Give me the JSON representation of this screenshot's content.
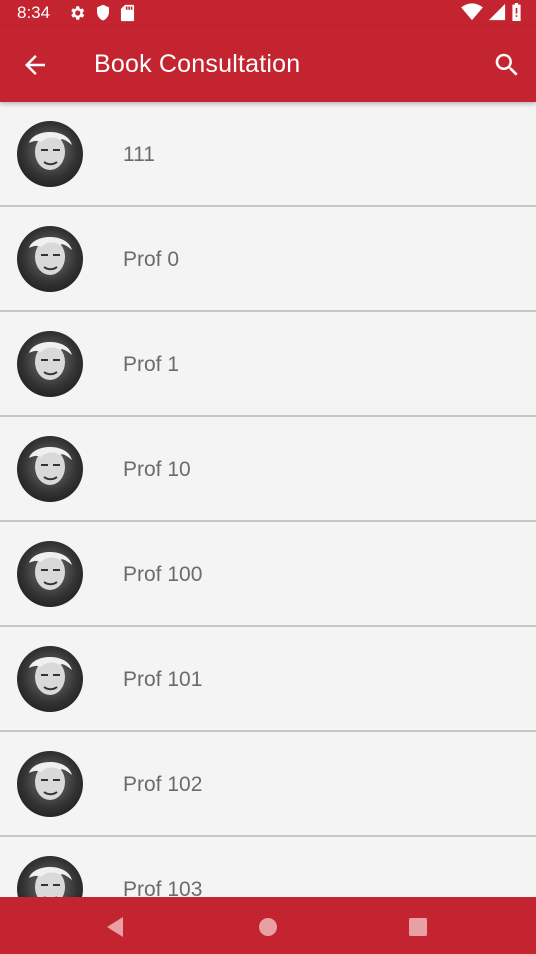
{
  "status_bar": {
    "time": "8:34",
    "left_icons": [
      "gear-icon",
      "shield-icon",
      "sd-card-icon"
    ],
    "right_icons": [
      "wifi-icon",
      "signal-icon",
      "battery-icon"
    ]
  },
  "app_bar": {
    "title": "Book Consultation",
    "back_icon": "arrow-left-icon",
    "search_icon": "search-icon"
  },
  "consultants": [
    {
      "name": "111"
    },
    {
      "name": "Prof 0"
    },
    {
      "name": "Prof 1"
    },
    {
      "name": "Prof 10"
    },
    {
      "name": "Prof 100"
    },
    {
      "name": "Prof 101"
    },
    {
      "name": "Prof 102"
    },
    {
      "name": "Prof 103"
    }
  ],
  "nav_bar": {
    "buttons": [
      "back-triangle-icon",
      "home-circle-icon",
      "recents-square-icon"
    ]
  },
  "colors": {
    "primary": "#c4242f",
    "background": "#f4f4f4",
    "divider": "#c6c6c6",
    "item_text": "#6b6b6b"
  }
}
